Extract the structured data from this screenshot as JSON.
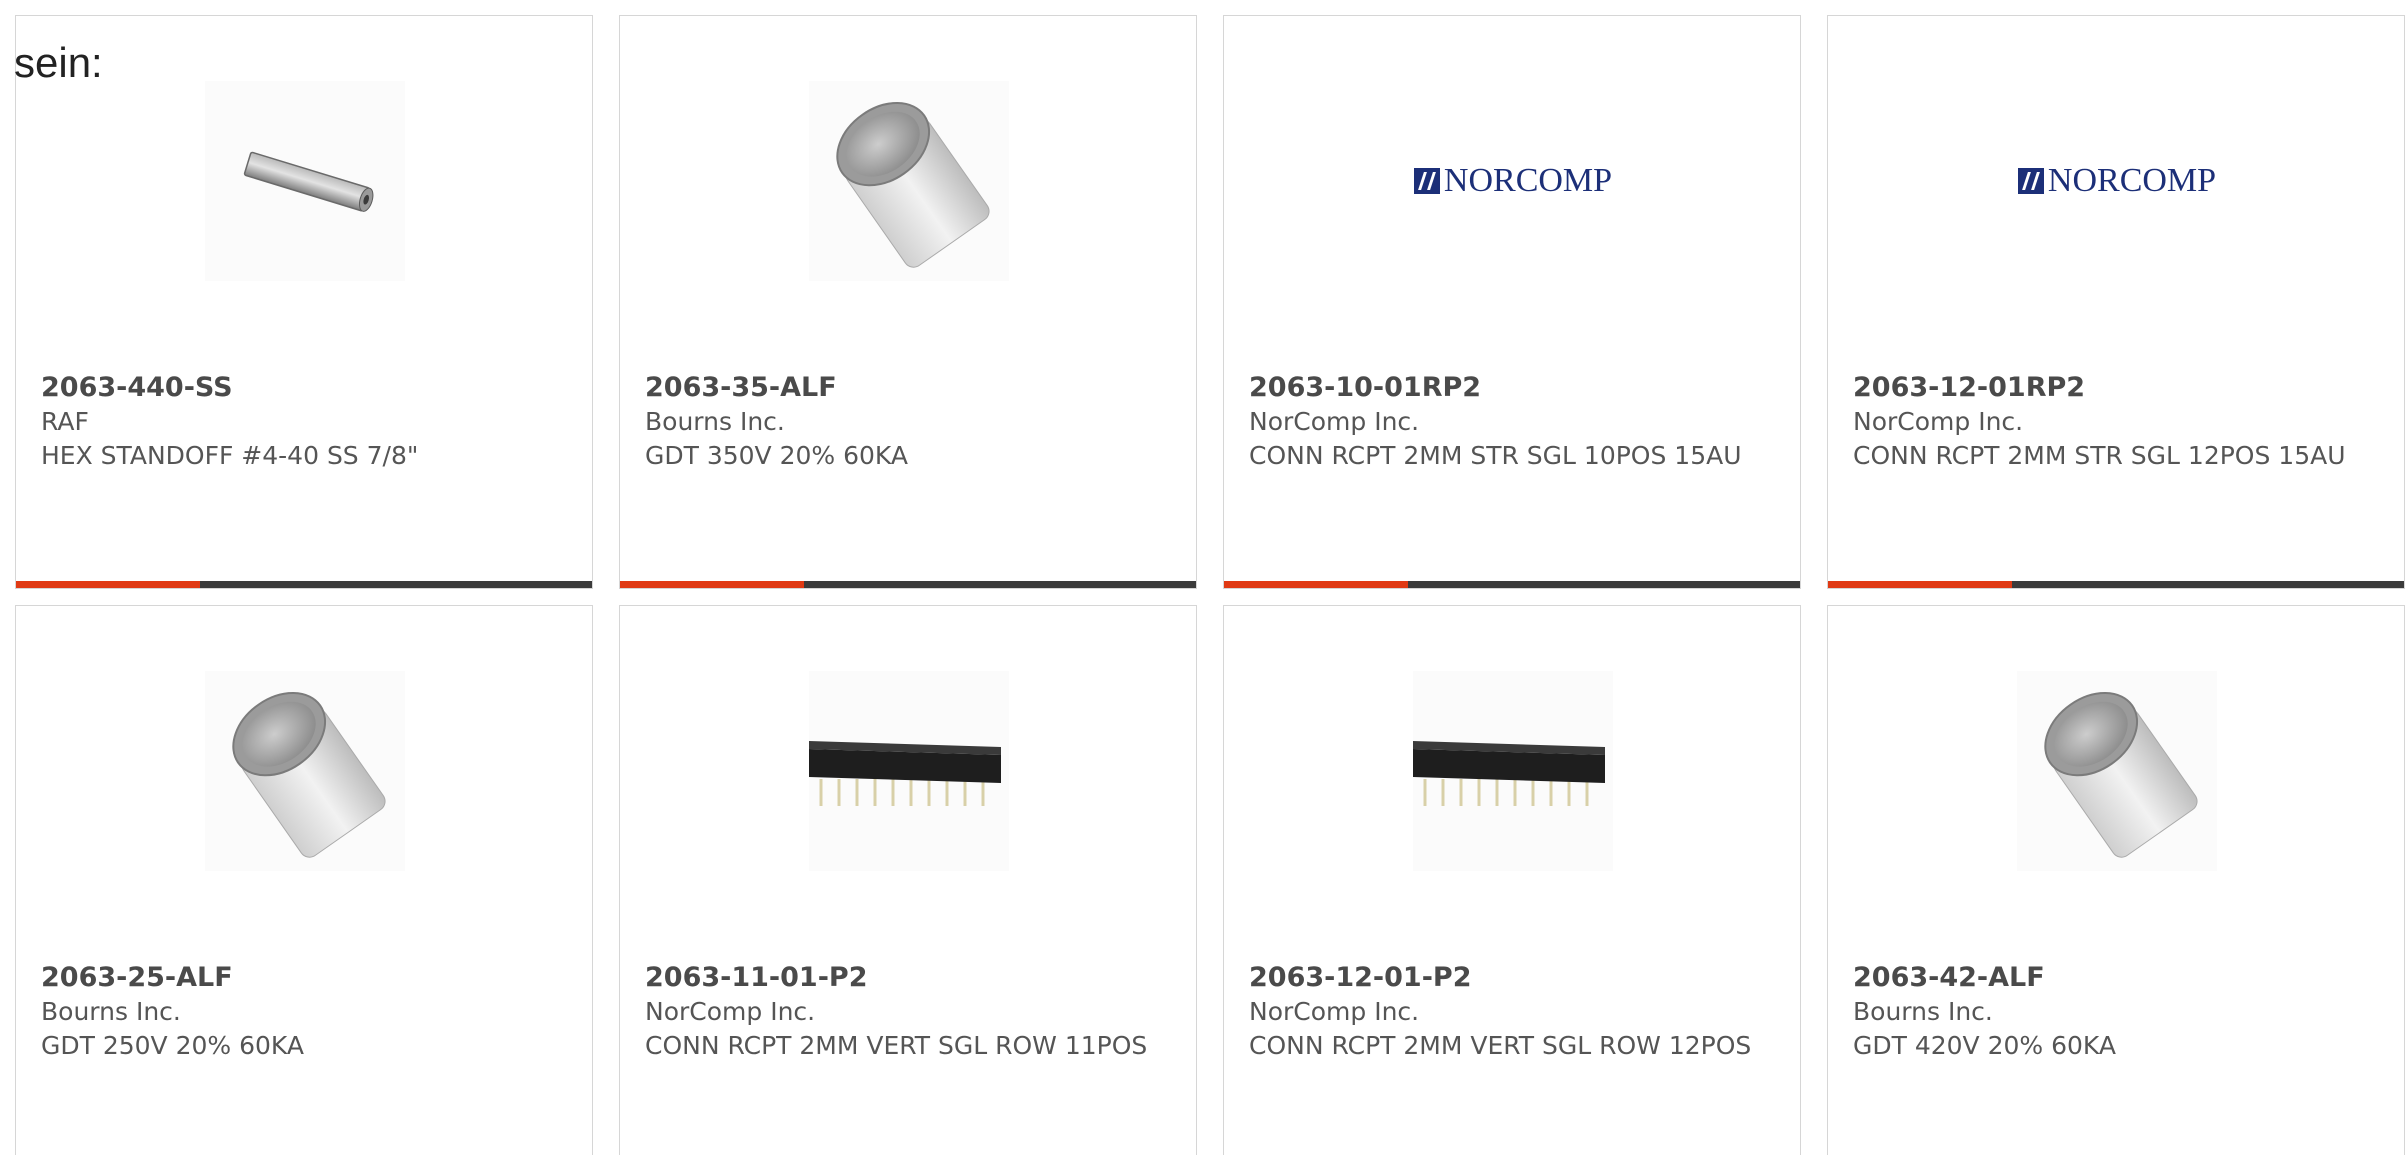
{
  "intro_text": "sein:",
  "colors": {
    "accent": "#e03a14",
    "bar_track": "#3b3b3b",
    "border": "#d6d6d6",
    "logo_blue": "#1c2f78"
  },
  "products": [
    {
      "part_number": "2063-440-SS",
      "manufacturer": "RAF",
      "description": "HEX STANDOFF #4-40 SS 7/8\"",
      "image": "hex-standoff-image",
      "progress": 0.32
    },
    {
      "part_number": "2063-35-ALF",
      "manufacturer": "Bourns Inc.",
      "description": "GDT 350V 20% 60KA",
      "image": "gas-discharge-tube-image",
      "progress": 0.32
    },
    {
      "part_number": "2063-10-01RP2",
      "manufacturer": "NorComp Inc.",
      "description": "CONN RCPT 2MM STR SGL 10POS 15AU",
      "image": "norcomp-logo",
      "logo_text": "NORCOMP",
      "progress": 0.32
    },
    {
      "part_number": "2063-12-01RP2",
      "manufacturer": "NorComp Inc.",
      "description": "CONN RCPT 2MM STR SGL 12POS 15AU",
      "image": "norcomp-logo",
      "logo_text": "NORCOMP",
      "progress": 0.32
    },
    {
      "part_number": "2063-25-ALF",
      "manufacturer": "Bourns Inc.",
      "description": "GDT 250V 20% 60KA",
      "image": "gas-discharge-tube-image"
    },
    {
      "part_number": "2063-11-01-P2",
      "manufacturer": "NorComp Inc.",
      "description": "CONN RCPT 2MM VERT SGL ROW 11POS",
      "image": "pin-header-connector-image"
    },
    {
      "part_number": "2063-12-01-P2",
      "manufacturer": "NorComp Inc.",
      "description": "CONN RCPT 2MM VERT SGL ROW 12POS",
      "image": "pin-header-connector-image"
    },
    {
      "part_number": "2063-42-ALF",
      "manufacturer": "Bourns Inc.",
      "description": "GDT 420V 20% 60KA",
      "image": "gas-discharge-tube-image"
    }
  ]
}
